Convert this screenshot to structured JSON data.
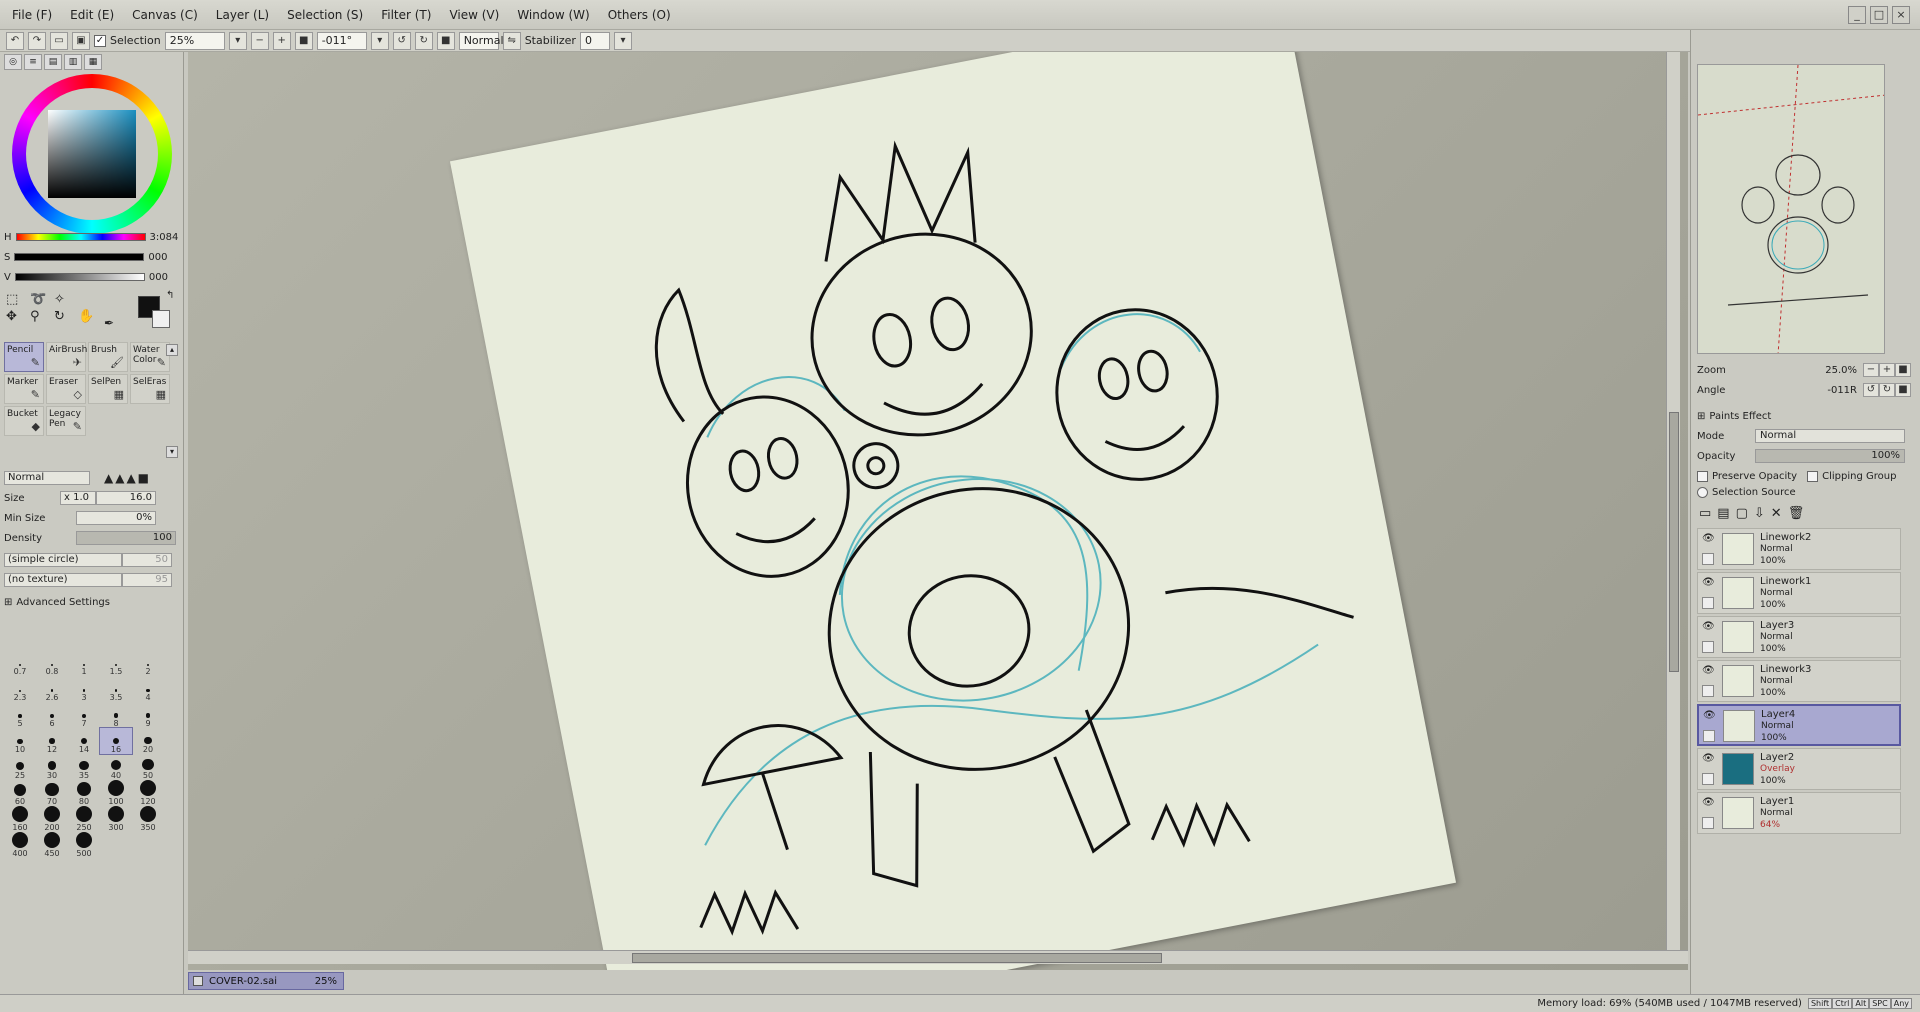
{
  "menu": [
    {
      "label": "File (F)"
    },
    {
      "label": "Edit (E)"
    },
    {
      "label": "Canvas (C)"
    },
    {
      "label": "Layer (L)"
    },
    {
      "label": "Selection (S)"
    },
    {
      "label": "Filter (T)"
    },
    {
      "label": "View (V)"
    },
    {
      "label": "Window (W)"
    },
    {
      "label": "Others (O)"
    }
  ],
  "toolbar": {
    "selection_label": "Selection",
    "zoom": "25%",
    "angle": "-011°",
    "blend": "Normal",
    "stabilizer_label": "Stabilizer",
    "stabilizer_value": "0"
  },
  "color": {
    "h_label": "H",
    "h_value": "3:084",
    "s_label": "S",
    "s_value": "000",
    "v_label": "V",
    "v_value": "000",
    "primary": "#111111",
    "wheel_accent": "#1a8fc0"
  },
  "tools": [
    {
      "label": "Pencil",
      "icon": "pencil-icon",
      "glyph": "✎",
      "active": true
    },
    {
      "label": "AirBrush",
      "icon": "airbrush-icon",
      "glyph": "✈",
      "active": false
    },
    {
      "label": "Brush",
      "icon": "brush-icon",
      "glyph": "🖌",
      "active": false
    },
    {
      "label": "Water Color",
      "icon": "watercolor-icon",
      "glyph": "✎",
      "active": false
    },
    {
      "label": "Marker",
      "icon": "marker-icon",
      "glyph": "✎",
      "active": false
    },
    {
      "label": "Eraser",
      "icon": "eraser-icon",
      "glyph": "◇",
      "active": false
    },
    {
      "label": "SelPen",
      "icon": "selpen-icon",
      "glyph": "▦",
      "active": false
    },
    {
      "label": "SelEras",
      "icon": "seleras-icon",
      "glyph": "▦",
      "active": false
    },
    {
      "label": "Bucket",
      "icon": "bucket-icon",
      "glyph": "◆",
      "active": false
    },
    {
      "label": "Legacy Pen",
      "icon": "legacy-pen-icon",
      "glyph": "✎",
      "active": false
    }
  ],
  "brush": {
    "mode": "Normal",
    "size_label": "Size",
    "size_mult": "x 1.0",
    "size_value": "16.0",
    "minsize_label": "Min Size",
    "minsize_value": "0%",
    "density_label": "Density",
    "density_value": "100",
    "shape": "(simple circle)",
    "shape_value": "50",
    "texture": "(no texture)",
    "texture_value": "95",
    "advanced_label": "Advanced Settings"
  },
  "brush_sizes": [
    "0.7",
    "0.8",
    "1",
    "1.5",
    "2",
    "2.3",
    "2.6",
    "3",
    "3.5",
    "4",
    "5",
    "6",
    "7",
    "8",
    "9",
    "10",
    "12",
    "14",
    "16",
    "20",
    "25",
    "30",
    "35",
    "40",
    "50",
    "60",
    "70",
    "80",
    "100",
    "120",
    "160",
    "200",
    "250",
    "300",
    "350",
    "400",
    "450",
    "500"
  ],
  "brush_size_active": "16",
  "document": {
    "name": "COVER-02.sai",
    "zoom": "25%"
  },
  "navigator": {
    "zoom_label": "Zoom",
    "zoom_value": "25.0%",
    "angle_label": "Angle",
    "angle_value": "-011R"
  },
  "layer_panel": {
    "paints_effect": "Paints Effect",
    "mode_label": "Mode",
    "mode_value": "Normal",
    "opacity_label": "Opacity",
    "opacity_value": "100%",
    "preserve_opacity": "Preserve Opacity",
    "clipping_group": "Clipping Group",
    "selection_source": "Selection Source"
  },
  "layers": [
    {
      "name": "Linework2",
      "mode": "Normal",
      "opacity": "100%",
      "selected": false,
      "thumb": "#e8ecdc",
      "overlay": false
    },
    {
      "name": "Linework1",
      "mode": "Normal",
      "opacity": "100%",
      "selected": false,
      "thumb": "#e8ecdc",
      "overlay": false
    },
    {
      "name": "Layer3",
      "mode": "Normal",
      "opacity": "100%",
      "selected": false,
      "thumb": "#e8ecdc",
      "overlay": false
    },
    {
      "name": "Linework3",
      "mode": "Normal",
      "opacity": "100%",
      "selected": false,
      "thumb": "#e8ecdc",
      "overlay": false
    },
    {
      "name": "Layer4",
      "mode": "Normal",
      "opacity": "100%",
      "selected": true,
      "thumb": "#e8ecdc",
      "overlay": false
    },
    {
      "name": "Layer2",
      "mode": "Overlay",
      "opacity": "100%",
      "selected": false,
      "thumb": "#1a6e80",
      "overlay": true
    },
    {
      "name": "Layer1",
      "mode": "Normal",
      "opacity": "64%",
      "selected": false,
      "thumb": "#e8ecdc",
      "overlay": false
    }
  ],
  "status": {
    "memory": "Memory load: 69% (540MB used / 1047MB reserved)",
    "keys": [
      "Shift",
      "Ctrl",
      "Alt",
      "SPC",
      "Any"
    ]
  }
}
